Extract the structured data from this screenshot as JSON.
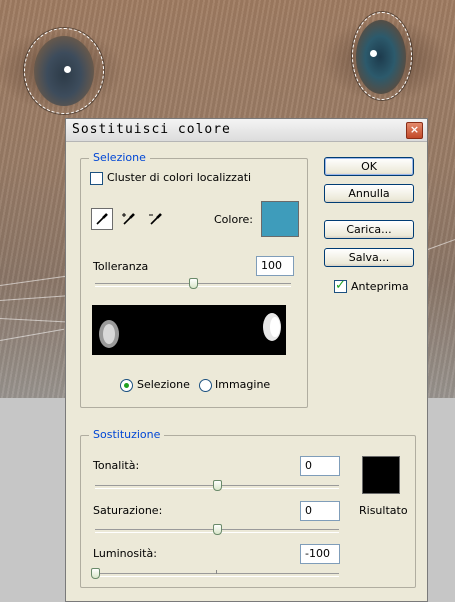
{
  "dialog": {
    "title": "Sostituisci colore",
    "close_glyph": "×"
  },
  "selection": {
    "group_title": "Selezione",
    "cluster_label": "Cluster di colori localizzati",
    "cluster_checked": false,
    "color_label": "Colore:",
    "color_value": "#3e9cbb",
    "tolerance_label": "Tolleranza",
    "tolerance_value": "100",
    "tolerance_level": 0.5,
    "radio_selection_label": "Selezione",
    "radio_image_label": "Immagine",
    "radio_selected": "Selezione",
    "eyedroppers": [
      "eyedropper-icon",
      "eyedropper-plus-icon",
      "eyedropper-minus-icon"
    ]
  },
  "buttons": {
    "ok": "OK",
    "cancel": "Annulla",
    "load": "Carica...",
    "save": "Salva...",
    "preview_label": "Anteprima",
    "preview_checked": true
  },
  "replacement": {
    "group_title": "Sostituzione",
    "hue_label": "Tonalità:",
    "hue_value": "0",
    "hue_level": 0.5,
    "saturation_label": "Saturazione:",
    "saturation_value": "0",
    "saturation_level": 0.5,
    "lightness_label": "Luminosità:",
    "lightness_value": "-100",
    "lightness_level": 0,
    "result_label": "Risultato",
    "result_color": "#000000"
  }
}
